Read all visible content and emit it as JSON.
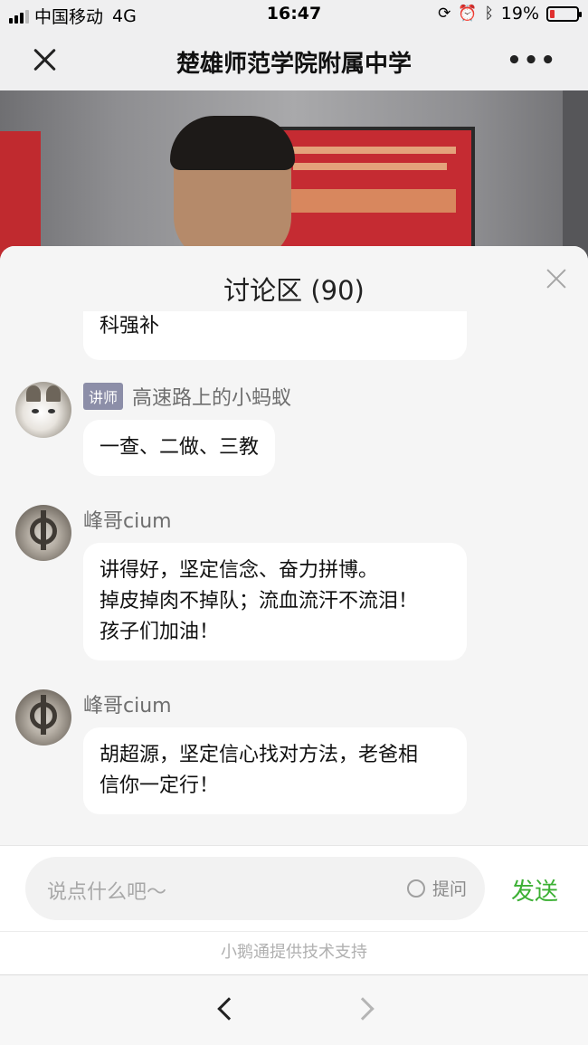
{
  "status_bar": {
    "carrier": "中国移动",
    "network": "4G",
    "time": "16:47",
    "battery": "19%",
    "battery_level": 0.19
  },
  "nav": {
    "title": "楚雄师范学院附属中学",
    "more": "•••"
  },
  "panel": {
    "title": "讨论区 (90)"
  },
  "messages": [
    {
      "author": "",
      "role": "",
      "lines": [
        "科强补"
      ]
    },
    {
      "author": "高速路上的小蚂蚁",
      "role": "讲师",
      "lines": [
        "一查、二做、三教"
      ]
    },
    {
      "author": "峰哥cium",
      "role": "",
      "lines": [
        "讲得好，坚定信念、奋力拼博。",
        "掉皮掉肉不掉队；流血流汗不流泪！",
        "孩子们加油！"
      ]
    },
    {
      "author": "峰哥cium",
      "role": "",
      "lines": [
        "胡超源，坚定信心找对方法，老爸相",
        "信你一定行！"
      ]
    }
  ],
  "input": {
    "placeholder": "说点什么吧～",
    "ask_label": "提问",
    "send_label": "发送"
  },
  "footer": {
    "powered_by": "小鹅通提供技术支持"
  },
  "colors": {
    "send": "#3cb034",
    "role_badge": "#8c8ea8",
    "battery_low": "#e03030"
  }
}
